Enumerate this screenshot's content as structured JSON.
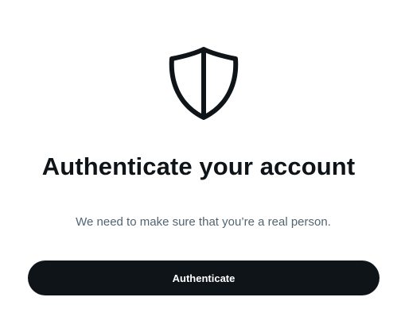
{
  "icon": "shield-icon",
  "title": "Authenticate your account",
  "subtitle": "We need to make sure that you’re a real person.",
  "button": {
    "label": "Authenticate"
  },
  "colors": {
    "text_primary": "#0f1419",
    "text_secondary": "#536471",
    "button_bg": "#0f1419",
    "button_text": "#ffffff",
    "background": "#ffffff"
  }
}
